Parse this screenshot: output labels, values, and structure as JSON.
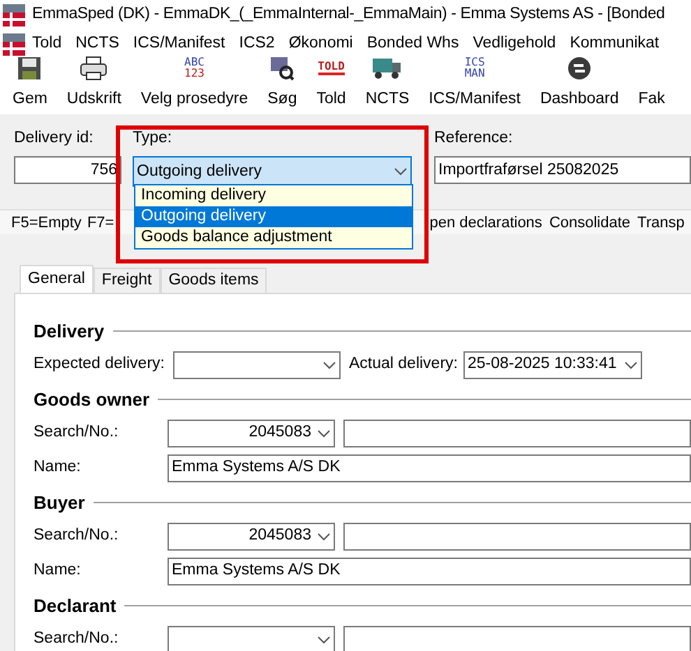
{
  "window": {
    "title": "EmmaSped (DK) - EmmaDK_(_EmmaInternal-_EmmaMain) - Emma Systems AS - [Bonded"
  },
  "menu": [
    "Told",
    "NCTS",
    "ICS/Manifest",
    "ICS2",
    "Økonomi",
    "Bonded Whs",
    "Vedligehold",
    "Kommunikat"
  ],
  "toolbar": [
    {
      "label": "Gem"
    },
    {
      "label": "Udskrift"
    },
    {
      "label": "Velg prosedyre",
      "icon_text": [
        "ABC",
        "123"
      ]
    },
    {
      "label": "Søg"
    },
    {
      "label": "Told",
      "icon_text": [
        "TOLD"
      ]
    },
    {
      "label": "NCTS"
    },
    {
      "label": "ICS/Manifest",
      "icon_text": [
        "ICS",
        "MAN"
      ]
    },
    {
      "label": "Dashboard"
    },
    {
      "label": "Fak"
    }
  ],
  "header": {
    "delivery_id": {
      "label": "Delivery id:",
      "value": "756"
    },
    "type": {
      "label": "Type:",
      "value": "Outgoing delivery",
      "expanded": true,
      "options": [
        {
          "label": "Incoming delivery",
          "selected": false
        },
        {
          "label": "Outgoing delivery",
          "selected": true
        },
        {
          "label": "Goods balance adjustment",
          "selected": false
        }
      ]
    },
    "reference": {
      "label": "Reference:",
      "value": "Importfraførsel 25082025"
    }
  },
  "function_bar": [
    "F5=Empty",
    "F7=",
    "pen declarations",
    "Consolidate",
    "Transp"
  ],
  "tabs": [
    {
      "label": "General",
      "selected": true
    },
    {
      "label": "Freight",
      "selected": false
    },
    {
      "label": "Goods items",
      "selected": false
    }
  ],
  "sections": [
    {
      "kind": "delivery",
      "title": "Delivery",
      "expected": {
        "label": "Expected delivery:"
      },
      "actual": {
        "label": "Actual delivery:",
        "value": "25-08-2025 10:33:41"
      }
    },
    {
      "kind": "party",
      "title": "Goods owner",
      "search": {
        "label": "Search/No.:",
        "value": "2045083"
      },
      "name": {
        "label": "Name:",
        "value": "Emma Systems A/S DK"
      }
    },
    {
      "kind": "party",
      "title": "Buyer",
      "search": {
        "label": "Search/No.:",
        "value": "2045083"
      },
      "name": {
        "label": "Name:",
        "value": "Emma Systems A/S DK"
      }
    },
    {
      "kind": "party",
      "title": "Declarant",
      "search": {
        "label": "Search/No.:"
      }
    }
  ]
}
